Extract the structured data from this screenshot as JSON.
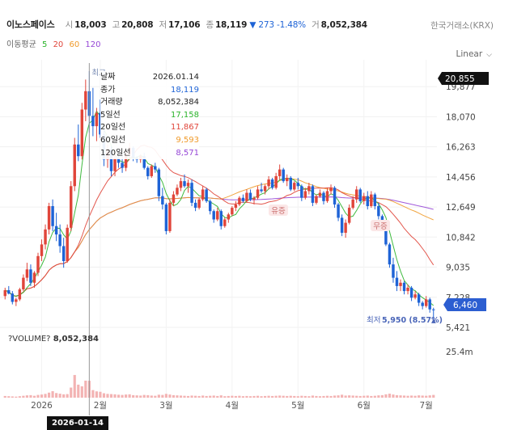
{
  "header": {
    "name": "이노스페이스",
    "open_label": "시",
    "open": "18,003",
    "high_label": "고",
    "high": "20,808",
    "low_label": "저",
    "low": "17,106",
    "close_label": "종",
    "close": "18,119",
    "change": "▼ 273 -1.48%",
    "vol_label": "거",
    "volume": "8,052,384",
    "exchange": "한국거래소(KRX)"
  },
  "ma_legend": {
    "label": "이동평균",
    "p5": "5",
    "p20": "20",
    "p60": "60",
    "p120": "120"
  },
  "scale_label": "Linear",
  "volume_header": {
    "label": "?VOLUME?",
    "value": "8,052,384"
  },
  "tooltip": {
    "rows": [
      {
        "label": "날짜",
        "value": "2026.01.14",
        "color": "#222222"
      },
      {
        "label": "종가",
        "value": "18,119",
        "color": "#1e63d6"
      },
      {
        "label": "거래량",
        "value": "8,052,384",
        "color": "#222222"
      },
      {
        "label": "5일선",
        "value": "17,158",
        "color": "#2ab32a"
      },
      {
        "label": "20일선",
        "value": "11,867",
        "color": "#e0453a"
      },
      {
        "label": "60일선",
        "value": "9,593",
        "color": "#f09a2a"
      },
      {
        "label": "120일선",
        "value": "8,571",
        "color": "#9646d6"
      }
    ]
  },
  "crosshair_date": "2026-01-14",
  "annotations": {
    "high_label": "최고",
    "low_label": "최저",
    "low_value": "5,950 (8.57%)",
    "event1": "유증",
    "event2": "무증"
  },
  "colors": {
    "up": "#e0453a",
    "down": "#1e63d6",
    "ma5": "#2ab32a",
    "ma20": "#e0453a",
    "ma60": "#f09a2a",
    "ma120": "#9646d6"
  },
  "chart_data": {
    "type": "candlestick",
    "y_axis_ticks": [
      "19,877",
      "18,070",
      "16,263",
      "14,456",
      "12,649",
      "10,842",
      "9,035",
      "7,228",
      "5,421"
    ],
    "current_price_label": "20,855",
    "last_price_label": "6,460",
    "volume_axis_ticks": [
      "25.4m"
    ],
    "x_axis_ticks": [
      "2026",
      "2월",
      "3월",
      "4월",
      "5월",
      "6월",
      "7월"
    ],
    "ylim": [
      5421,
      21000
    ],
    "ohlc": [
      [
        7300,
        7800,
        7100,
        7650
      ],
      [
        7650,
        7900,
        7400,
        7450
      ],
      [
        7450,
        7600,
        6800,
        6950
      ],
      [
        6950,
        7200,
        6700,
        7100
      ],
      [
        7100,
        7800,
        7000,
        7700
      ],
      [
        7700,
        8600,
        7600,
        8400
      ],
      [
        8400,
        9300,
        8200,
        8900
      ],
      [
        8900,
        9200,
        7900,
        8100
      ],
      [
        8100,
        8800,
        7800,
        8700
      ],
      [
        8700,
        9900,
        8500,
        9700
      ],
      [
        9700,
        10700,
        9400,
        10400
      ],
      [
        10400,
        11600,
        10100,
        11300
      ],
      [
        11300,
        12900,
        11000,
        12700
      ],
      [
        12700,
        13100,
        11200,
        11500
      ],
      [
        11500,
        12300,
        10600,
        11000
      ],
      [
        11000,
        11600,
        9900,
        10300
      ],
      [
        10300,
        10800,
        9000,
        9400
      ],
      [
        9400,
        11600,
        9300,
        11400
      ],
      [
        11400,
        14200,
        11200,
        13900
      ],
      [
        13900,
        16800,
        13600,
        16400
      ],
      [
        16400,
        17600,
        15400,
        15700
      ],
      [
        15700,
        18900,
        15500,
        18500
      ],
      [
        18500,
        20300,
        17800,
        19600
      ],
      [
        19600,
        20808,
        17106,
        18119
      ],
      [
        18119,
        19800,
        16900,
        17500
      ],
      [
        17500,
        18600,
        16600,
        18300
      ],
      [
        18300,
        19100,
        16800,
        17000
      ],
      [
        17000,
        17300,
        15100,
        15500
      ],
      [
        15500,
        16400,
        15000,
        16100
      ],
      [
        16100,
        16300,
        14500,
        14800
      ],
      [
        14800,
        15800,
        14500,
        15600
      ],
      [
        15600,
        16100,
        15000,
        15300
      ],
      [
        15300,
        15700,
        14700,
        15000
      ],
      [
        15000,
        16000,
        14800,
        15800
      ],
      [
        15800,
        16500,
        15600,
        16200
      ],
      [
        16200,
        16300,
        15400,
        15600
      ],
      [
        15600,
        15700,
        15300,
        15500
      ],
      [
        15500,
        15800,
        15300,
        15700
      ],
      [
        15700,
        15900,
        14900,
        15000
      ],
      [
        15000,
        15100,
        14300,
        14500
      ],
      [
        14500,
        15200,
        14400,
        15100
      ],
      [
        15100,
        15300,
        14700,
        14900
      ],
      [
        14900,
        15000,
        13000,
        13300
      ],
      [
        13300,
        13800,
        12500,
        12800
      ],
      [
        12800,
        12900,
        11000,
        11200
      ],
      [
        11200,
        13100,
        11100,
        12900
      ],
      [
        12900,
        13600,
        12700,
        13400
      ],
      [
        13400,
        14000,
        13300,
        13800
      ],
      [
        13800,
        14400,
        13600,
        14200
      ],
      [
        14200,
        14600,
        13800,
        13900
      ],
      [
        13900,
        14300,
        13500,
        14100
      ],
      [
        14100,
        14300,
        12700,
        12900
      ],
      [
        12900,
        13100,
        12400,
        12600
      ],
      [
        12600,
        13200,
        12500,
        13100
      ],
      [
        13100,
        13900,
        13000,
        13700
      ],
      [
        13700,
        13800,
        12900,
        13000
      ],
      [
        13000,
        13100,
        12200,
        12400
      ],
      [
        12400,
        12500,
        11700,
        11900
      ],
      [
        11900,
        12600,
        11800,
        12400
      ],
      [
        12400,
        12500,
        11300,
        11500
      ],
      [
        11500,
        12000,
        11400,
        11900
      ],
      [
        11900,
        12300,
        11700,
        12200
      ],
      [
        12200,
        12700,
        12100,
        12600
      ],
      [
        12600,
        13000,
        12400,
        12800
      ],
      [
        12800,
        13300,
        12700,
        13200
      ],
      [
        13200,
        13400,
        12900,
        13000
      ],
      [
        13000,
        13700,
        12900,
        13500
      ],
      [
        13500,
        13700,
        13000,
        13100
      ],
      [
        13100,
        13300,
        12800,
        13200
      ],
      [
        13200,
        13900,
        13100,
        13700
      ],
      [
        13700,
        14100,
        13500,
        13600
      ],
      [
        13600,
        14000,
        13400,
        13900
      ],
      [
        13900,
        14500,
        13700,
        14300
      ],
      [
        14300,
        14400,
        13700,
        13800
      ],
      [
        13800,
        14700,
        13700,
        14500
      ],
      [
        14500,
        15200,
        14300,
        14900
      ],
      [
        14900,
        15000,
        14100,
        14200
      ],
      [
        14200,
        14600,
        13900,
        14400
      ],
      [
        14400,
        14500,
        13600,
        13700
      ],
      [
        13700,
        14200,
        13600,
        14100
      ],
      [
        14100,
        14400,
        13700,
        13900
      ],
      [
        13900,
        14000,
        13000,
        13200
      ],
      [
        13200,
        13800,
        13100,
        13600
      ],
      [
        13600,
        14100,
        13400,
        13900
      ],
      [
        13900,
        14000,
        12700,
        12900
      ],
      [
        12900,
        13400,
        12800,
        13300
      ],
      [
        13300,
        13700,
        13200,
        13500
      ],
      [
        13500,
        13600,
        12800,
        13000
      ],
      [
        13000,
        13800,
        12900,
        13600
      ],
      [
        13600,
        14000,
        13400,
        13800
      ],
      [
        13800,
        13900,
        12600,
        12800
      ],
      [
        12800,
        12900,
        11800,
        12000
      ],
      [
        12000,
        12200,
        10900,
        11100
      ],
      [
        11100,
        11900,
        10800,
        11700
      ],
      [
        11700,
        12800,
        11600,
        12600
      ],
      [
        12600,
        13300,
        12500,
        13100
      ],
      [
        13100,
        13900,
        12900,
        13700
      ],
      [
        13700,
        13800,
        12900,
        13000
      ],
      [
        13000,
        13500,
        12800,
        13300
      ],
      [
        13300,
        13600,
        12500,
        12700
      ],
      [
        12700,
        13600,
        12600,
        13400
      ],
      [
        13400,
        13500,
        12500,
        12700
      ],
      [
        12700,
        12900,
        11900,
        12100
      ],
      [
        12100,
        12200,
        11400,
        11500
      ],
      [
        11500,
        11600,
        10300,
        10400
      ],
      [
        10400,
        10500,
        9000,
        9200
      ],
      [
        9200,
        9600,
        8100,
        8400
      ],
      [
        8400,
        8800,
        7600,
        7900
      ],
      [
        7900,
        8300,
        7600,
        8100
      ],
      [
        8100,
        8200,
        7400,
        7600
      ],
      [
        7600,
        8000,
        7400,
        7800
      ],
      [
        7800,
        7900,
        7000,
        7200
      ],
      [
        7200,
        7600,
        7100,
        7400
      ],
      [
        7400,
        7500,
        6700,
        6900
      ],
      [
        6900,
        7000,
        6500,
        6700
      ],
      [
        6700,
        7300,
        6600,
        7100
      ],
      [
        7100,
        7200,
        6300,
        6500
      ],
      [
        6500,
        6600,
        5950,
        6460
      ]
    ],
    "volume": [
      0.8,
      0.7,
      0.6,
      0.5,
      0.7,
      0.9,
      1.1,
      1.2,
      0.9,
      1.3,
      1.5,
      1.8,
      2.4,
      3.1,
      2.2,
      1.9,
      1.6,
      1.7,
      4.8,
      10.8,
      6.2,
      5.4,
      8.1,
      8.05,
      3.6,
      3.0,
      2.8,
      2.1,
      1.8,
      1.7,
      1.6,
      1.4,
      1.3,
      1.5,
      1.6,
      1.2,
      1.1,
      1.0,
      1.3,
      1.2,
      1.0,
      0.9,
      1.4,
      1.3,
      1.8,
      1.5,
      1.2,
      1.1,
      1.0,
      0.9,
      0.8,
      1.0,
      0.9,
      0.8,
      1.0,
      0.8,
      0.9,
      1.0,
      0.8,
      1.1,
      0.7,
      0.8,
      0.9,
      0.8,
      0.9,
      0.7,
      0.8,
      0.7,
      0.8,
      0.9,
      0.7,
      0.8,
      0.9,
      0.8,
      0.9,
      1.0,
      0.9,
      0.8,
      0.9,
      0.8,
      0.7,
      0.9,
      0.8,
      0.7,
      1.0,
      0.8,
      0.7,
      0.8,
      0.9,
      0.8,
      1.0,
      1.1,
      1.4,
      1.0,
      1.1,
      1.0,
      0.9,
      0.8,
      0.9,
      1.0,
      0.8,
      0.9,
      1.1,
      1.2,
      1.6,
      1.9,
      1.5,
      1.2,
      1.1,
      1.0,
      0.9,
      1.0,
      0.9,
      1.1,
      1.0,
      0.9,
      1.1,
      1.3
    ],
    "crosshair_index": 23
  }
}
